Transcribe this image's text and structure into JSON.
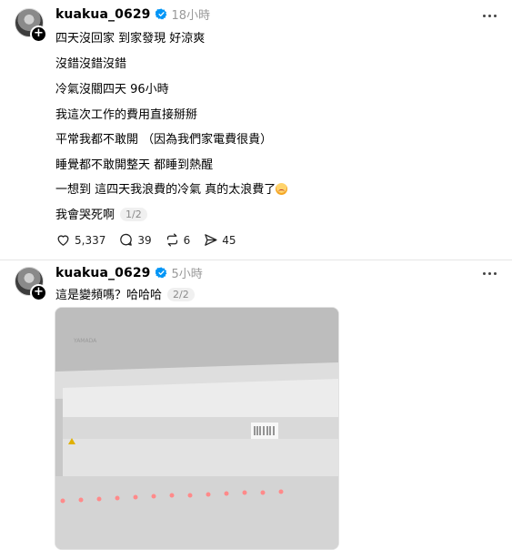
{
  "posts": [
    {
      "username": "kuakua_0629",
      "time": "18小時",
      "lines": [
        "四天沒回家 到家發現 好涼爽",
        "沒錯沒錯沒錯",
        "冷氣沒關四天 96小時",
        "我這次工作的費用直接掰掰",
        "平常我都不敢開 （因為我們家電費很貴）",
        "睡覺都不敢開整天 都睡到熱醒",
        "一想到 這四天我浪費的冷氣 真的太浪費了",
        "我會哭死啊"
      ],
      "pager": "1/2",
      "likes": "5,337",
      "comments": "39",
      "reposts": "6",
      "shares": "45"
    },
    {
      "username": "kuakua_0629",
      "time": "5小時",
      "lines": [
        "這是變頻嗎？哈哈哈"
      ],
      "pager": "2/2",
      "photo_caption": "YAMADA"
    }
  ],
  "icons": {
    "verified": "verified-badge-icon",
    "more": "more-options-icon",
    "like": "heart-icon",
    "comment": "comment-bubble-icon",
    "repost": "repost-icon",
    "share": "share-icon",
    "emoji": "crying-face-emoji"
  },
  "colors": {
    "verified": "#0095f6",
    "muted": "#999999",
    "divider": "#e6e6e6"
  }
}
